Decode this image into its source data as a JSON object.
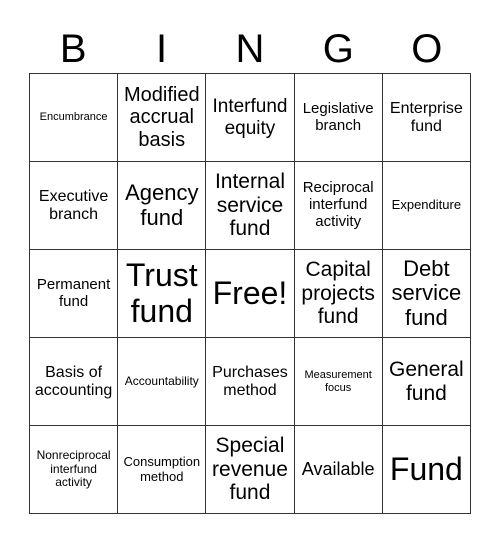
{
  "header": {
    "letters": [
      "B",
      "I",
      "N",
      "G",
      "O"
    ]
  },
  "board": {
    "rows": [
      [
        "Encumbrance",
        "Modified accrual basis",
        "Interfund equity",
        "Legislative branch",
        "Enterprise fund"
      ],
      [
        "Executive branch",
        "Agency fund",
        "Internal service fund",
        "Reciprocal interfund activity",
        "Expenditure"
      ],
      [
        "Permanent fund",
        "Trust fund",
        "Free!",
        "Capital projects fund",
        "Debt service fund"
      ],
      [
        "Basis of accounting",
        "Accountability",
        "Purchases method",
        "Measurement focus",
        "General fund"
      ],
      [
        "Nonreciprocal interfund activity",
        "Consumption method",
        "Special revenue fund",
        "Available",
        "Fund"
      ]
    ]
  }
}
